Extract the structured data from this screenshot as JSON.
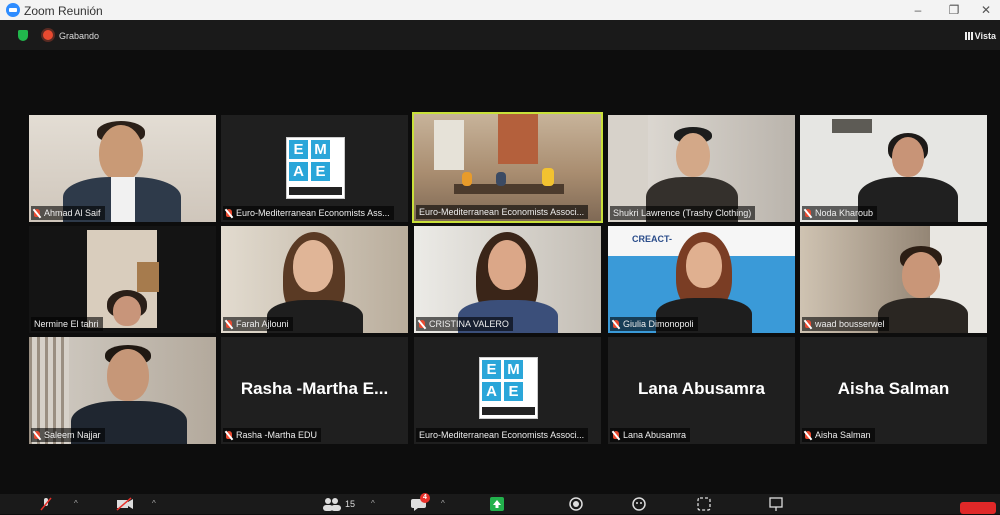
{
  "window": {
    "title": "Zoom Reunión",
    "minimize": "–",
    "restore": "❐",
    "close": "✕"
  },
  "meeting": {
    "recording_label": "Grabando",
    "view_label": "Vista"
  },
  "participants": [
    {
      "name": "Ahmad Al Saif",
      "muted": true,
      "video": true,
      "bg": "#d9d4cc"
    },
    {
      "name": "Euro-Mediterranean Economists Ass...",
      "muted": true,
      "video": false,
      "logo": true
    },
    {
      "name": "Euro-Mediterranean Economists Associ...",
      "muted": false,
      "video": true,
      "active": true,
      "bg": "#b9a48c"
    },
    {
      "name": "Shukri Lawrence (Trashy Clothing)",
      "muted": false,
      "video": true,
      "bg": "#c7c2ba"
    },
    {
      "name": "Noda Kharoub",
      "muted": true,
      "video": true,
      "bg": "#e4e4e2"
    },
    {
      "name": "Nermine El tahri",
      "muted": false,
      "video": true,
      "bg": "#1b1b1b"
    },
    {
      "name": "Farah Ajlouni",
      "muted": true,
      "video": true,
      "bg": "#ccc2b4"
    },
    {
      "name": "CRISTINA VALERO",
      "muted": true,
      "video": true,
      "bg": "#cbc6bf"
    },
    {
      "name": "Giulia Dimonopoli",
      "muted": true,
      "video": true,
      "bg": "#3a9ad8",
      "banner": "CREACT-"
    },
    {
      "name": "waad bousserwel",
      "muted": true,
      "video": true,
      "bg": "#9d8f80"
    },
    {
      "name": "Saleem Najjar",
      "muted": true,
      "video": true,
      "bg": "#cfcac2"
    },
    {
      "name": "Rasha -Martha EDU",
      "muted": true,
      "video": false,
      "display_name": "Rasha -Martha E..."
    },
    {
      "name": "Euro-Mediterranean Economists Associ...",
      "muted": false,
      "video": false,
      "logo": true
    },
    {
      "name": "Lana Abusamra",
      "muted": true,
      "video": false,
      "display_name": "Lana Abusamra"
    },
    {
      "name": "Aisha Salman",
      "muted": true,
      "video": false,
      "display_name": "Aisha Salman"
    }
  ],
  "toolbar": {
    "participants_count": "15",
    "chat_badge": "4"
  },
  "logo_text": {
    "top_left": "E",
    "top_right": "M",
    "bottom_left": "A",
    "bottom_right": "E"
  }
}
